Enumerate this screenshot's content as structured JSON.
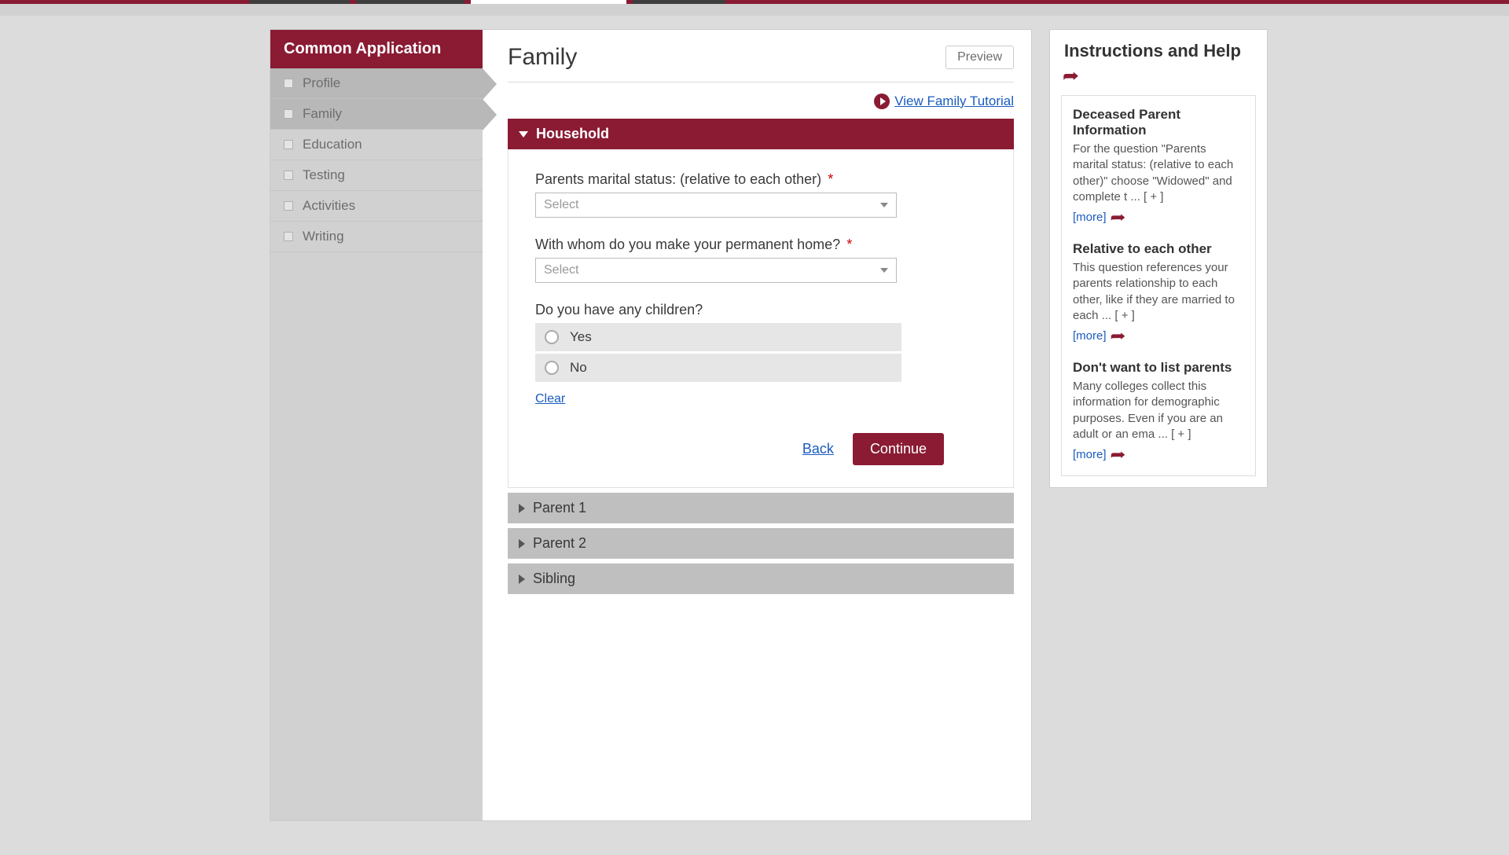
{
  "top_tabs": [
    "",
    "",
    "",
    ""
  ],
  "sidebar": {
    "header": "Common Application",
    "items": [
      {
        "label": "Profile",
        "highlighted": true
      },
      {
        "label": "Family",
        "highlighted": true
      },
      {
        "label": "Education",
        "highlighted": false
      },
      {
        "label": "Testing",
        "highlighted": false
      },
      {
        "label": "Activities",
        "highlighted": false
      },
      {
        "label": "Writing",
        "highlighted": false
      }
    ]
  },
  "main": {
    "title": "Family",
    "preview_label": "Preview",
    "tutorial_link": "View Family Tutorial",
    "sections": {
      "household": {
        "label": "Household",
        "q1_label": "Parents marital status: (relative to each other)",
        "q1_required": true,
        "q1_placeholder": "Select",
        "q2_label": "With whom do you make your permanent home?",
        "q2_required": true,
        "q2_placeholder": "Select",
        "q3_label": "Do you have any children?",
        "q3_opts": {
          "yes": "Yes",
          "no": "No"
        },
        "clear_label": "Clear",
        "back_label": "Back",
        "continue_label": "Continue"
      },
      "parent1": {
        "label": "Parent 1"
      },
      "parent2": {
        "label": "Parent 2"
      },
      "sibling": {
        "label": "Sibling"
      }
    }
  },
  "help": {
    "title": "Instructions and Help",
    "items": [
      {
        "title": "Deceased Parent Information",
        "text": "For the question \"Parents marital status: (relative to each other)\" choose \"Widowed\" and complete t ... [ + ]",
        "more": "[more]"
      },
      {
        "title": "Relative to each other",
        "text": "This question references your parents relationship to each other, like if they are married to each ... [ + ]",
        "more": "[more]"
      },
      {
        "title": "Don't want to list parents",
        "text": "Many colleges collect this information for demographic purposes. Even if you are an adult or an ema ... [ + ]",
        "more": "[more]"
      }
    ]
  }
}
